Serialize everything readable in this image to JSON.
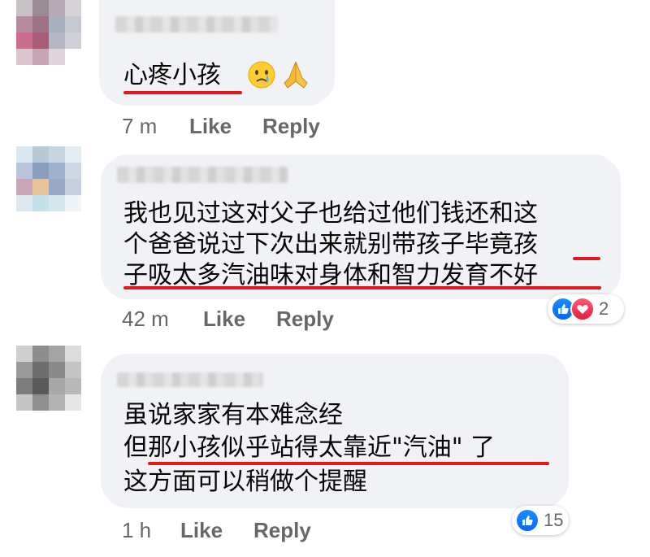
{
  "comments": [
    {
      "text_lines": [
        "心疼小孩"
      ],
      "time": "7 m",
      "like_label": "Like",
      "reply_label": "Reply",
      "emojis": [
        "crying-face-emoji",
        "folded-hands-emoji"
      ]
    },
    {
      "text_lines": [
        "我也见过这对父子也给过他们钱还和这",
        "个爸爸说过下次出来就别带孩子毕竟孩",
        "子吸太多汽油味对身体和智力发育不好"
      ],
      "time": "42 m",
      "like_label": "Like",
      "reply_label": "Reply",
      "reactions": {
        "icons": [
          "like-icon",
          "love-icon"
        ],
        "count": "2"
      }
    },
    {
      "text_lines": [
        "虽说家家有本难念经",
        "但那小孩似乎站得太靠近\"汽油\" 了",
        "这方面可以稍做个提醒"
      ],
      "time": "1 h",
      "like_label": "Like",
      "reply_label": "Reply",
      "reactions": {
        "icons": [
          "like-icon"
        ],
        "count": "15"
      }
    }
  ],
  "colors": {
    "bubble": "#f0f2f5",
    "meta_text": "#65676b",
    "underline": "#e0191c",
    "like_blue": "#0866ff",
    "love_red": "#e41e3f"
  }
}
